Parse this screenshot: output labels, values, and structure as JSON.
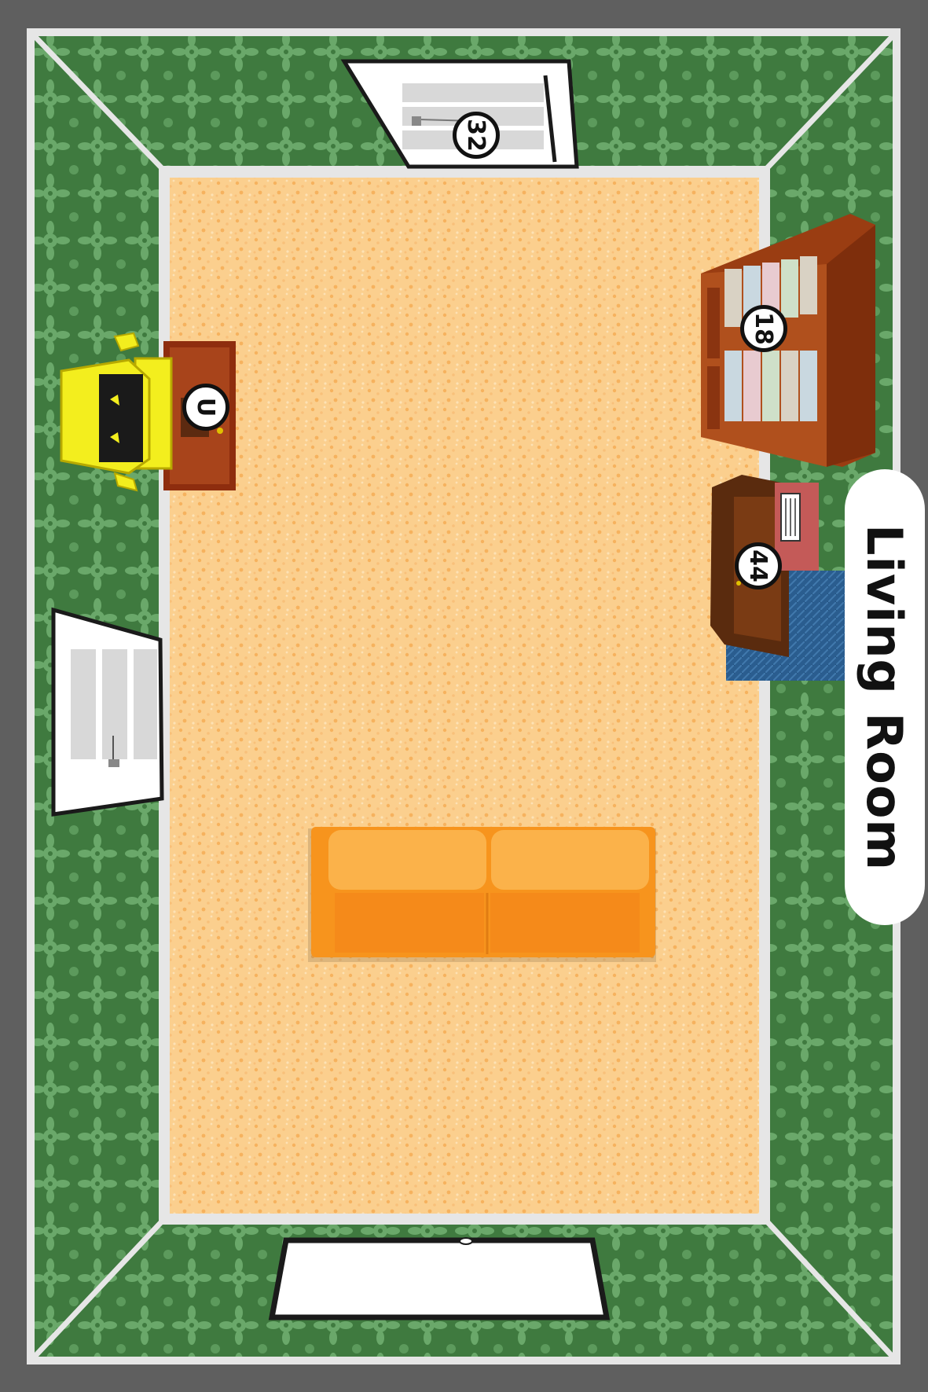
{
  "room": {
    "name": "Living Room",
    "wall_color": "#3f7a3f",
    "wall_pattern_color": "#6aa86a",
    "floor_color": "#fbcf8e",
    "floor_speckle_color": "#f6b25e",
    "trim_color": "#e6e6e6",
    "background_color": "#5f5f5f"
  },
  "objects": {
    "door_marker": "32",
    "bookshelf_marker": "18",
    "nightstand_marker": "44",
    "robot_marker": "U"
  },
  "sofa": {
    "color": "#f7941d",
    "cushion_color": "#fbb24a"
  }
}
